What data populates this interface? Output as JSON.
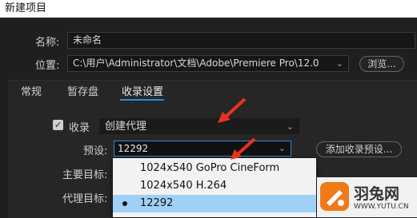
{
  "window": {
    "title": "新建项目"
  },
  "form": {
    "name_label": "名称:",
    "name_value": "未命名",
    "location_label": "位置:",
    "location_value": "C:\\用户\\Administrator\\文档\\Adobe\\Premiere Pro\\12.0",
    "browse_label": "浏览..."
  },
  "tabs": [
    {
      "label": "常规"
    },
    {
      "label": "暂存盘"
    },
    {
      "label": "收录设置",
      "active": true
    }
  ],
  "ingest": {
    "checkbox_label": "收录",
    "checkbox_checked": true,
    "mode_value": "创建代理",
    "preset_label": "预设:",
    "preset_value": "12292",
    "add_preset_label": "添加收录预设...",
    "primary_target_label": "主要目标:",
    "proxy_target_label": "代理目标:"
  },
  "preset_options": [
    {
      "label": "1024x540 GoPro CineForm",
      "selected": false
    },
    {
      "label": "1024x540 H.264",
      "selected": false
    },
    {
      "label": "12292",
      "selected": true
    }
  ],
  "annotation_color": "#e8321e",
  "watermark": {
    "text": "羽兔网",
    "url": "WWW.YUTU.CN"
  }
}
